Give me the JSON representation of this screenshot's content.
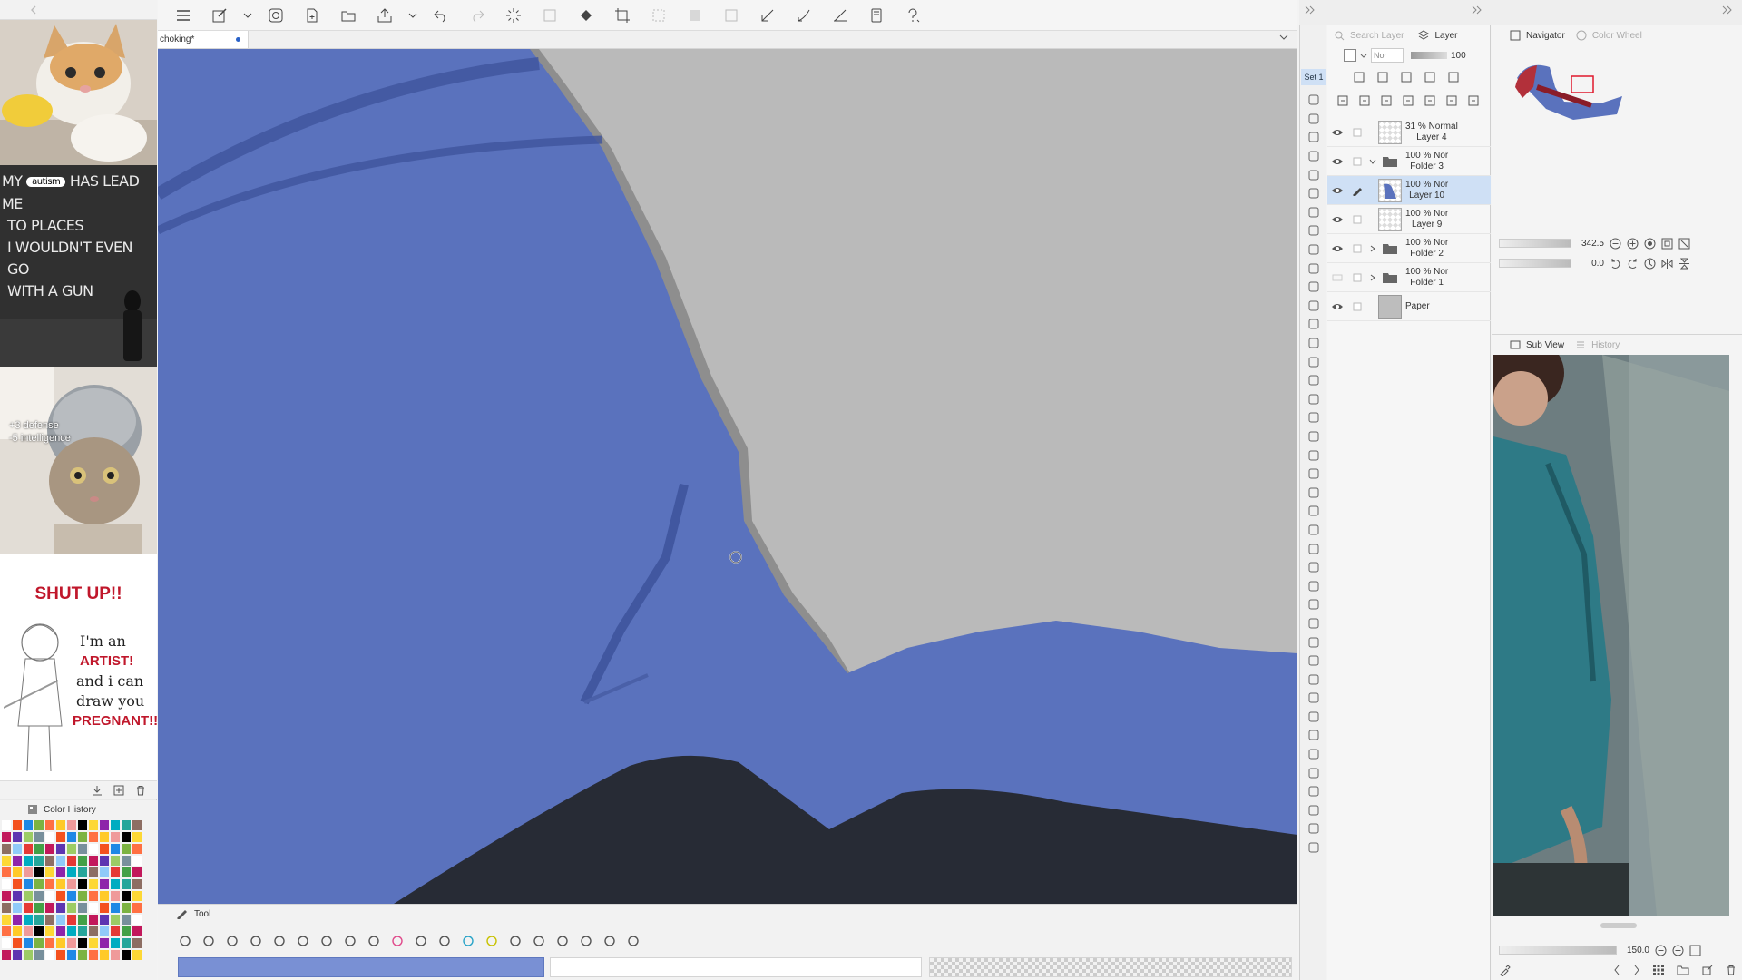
{
  "left_panel": {
    "meme2": {
      "badge": "autism",
      "line1a": "MY",
      "line1b": "HAS LEAD ME",
      "line2": "TO PLACES",
      "line3": "I WOULDN'T EVEN GO",
      "line4": "WITH A GUN"
    },
    "meme3": {
      "line1": "+3 defense",
      "line2": "-5 intelligence"
    },
    "meme4": {
      "title": "SHUT UP!!",
      "line1": "I'm an",
      "line2": "ARTIST!",
      "line3": "and i can",
      "line4": "draw you",
      "line5": "PREGNANT!!"
    },
    "color_history_title": "Color History"
  },
  "canvas": {
    "tab_title": "choking*",
    "fill_color": "#5a72bd",
    "background_color": "#b9b9b9"
  },
  "bottom_tool": {
    "tab_label": "Tool"
  },
  "command_strip": {
    "set_label": "Set 1"
  },
  "layer_panel": {
    "search_label": "Search Layer",
    "tab_label": "Layer",
    "blend_mode": "Nor",
    "opacity": "100",
    "layers": [
      {
        "opacity": "31 % Normal",
        "name": "Layer 4",
        "kind": "layer",
        "visible": true,
        "selected": false
      },
      {
        "opacity": "100 % Nor",
        "name": "Folder 3",
        "kind": "folder-open",
        "visible": true,
        "selected": false
      },
      {
        "opacity": "100 % Nor",
        "name": "Layer 10",
        "kind": "layer",
        "visible": true,
        "selected": true
      },
      {
        "opacity": "100 % Nor",
        "name": "Layer 9",
        "kind": "layer",
        "visible": true,
        "selected": false
      },
      {
        "opacity": "100 % Nor",
        "name": "Folder 2",
        "kind": "folder",
        "visible": true,
        "selected": false
      },
      {
        "opacity": "100 % Nor",
        "name": "Folder 1",
        "kind": "folder",
        "visible": false,
        "selected": false
      },
      {
        "opacity": "",
        "name": "Paper",
        "kind": "paper",
        "visible": true,
        "selected": false
      }
    ]
  },
  "navigator": {
    "tab_label": "Navigator",
    "tab2_label": "Color Wheel",
    "zoom_value": "342.5",
    "rotation_value": "0.0"
  },
  "sub_view": {
    "tab_label": "Sub View",
    "tab2_label": "History",
    "zoom_value": "150.0"
  }
}
